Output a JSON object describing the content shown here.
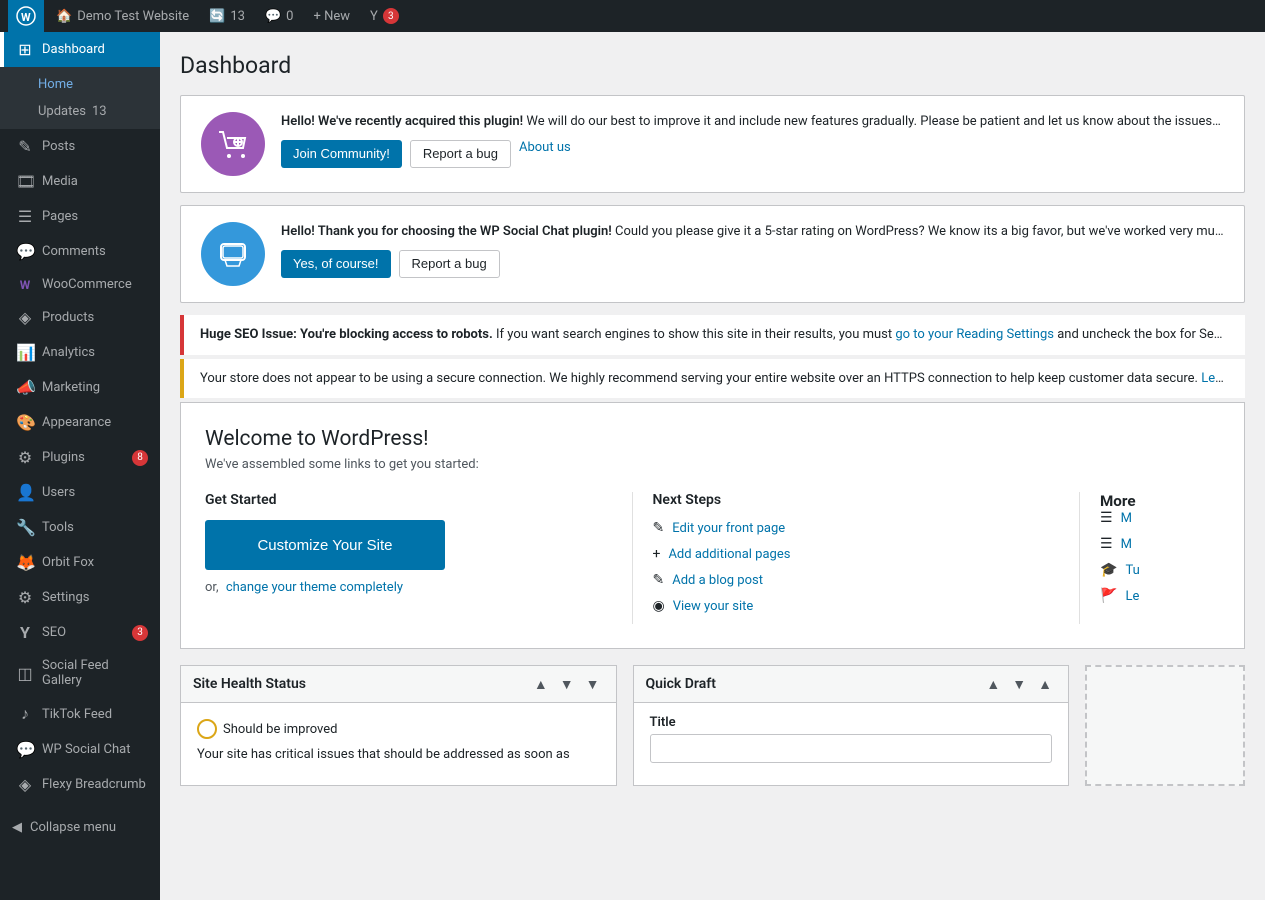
{
  "adminbar": {
    "wp_logo": "W",
    "site_name": "Demo Test Website",
    "comments_count": "0",
    "updates_count": "13",
    "new_label": "+ New",
    "yoast_label": "Y",
    "yoast_count": "3"
  },
  "sidebar": {
    "active_item": "Dashboard",
    "items": [
      {
        "id": "dashboard",
        "label": "Dashboard",
        "icon": "⊞",
        "badge": null,
        "active": true
      },
      {
        "id": "home",
        "label": "Home",
        "icon": null,
        "badge": null,
        "submenu": true,
        "subactive": true
      },
      {
        "id": "updates",
        "label": "Updates",
        "icon": null,
        "badge": "13",
        "submenu": true
      },
      {
        "id": "posts",
        "label": "Posts",
        "icon": "✎",
        "badge": null
      },
      {
        "id": "media",
        "label": "Media",
        "icon": "⊞",
        "badge": null
      },
      {
        "id": "pages",
        "label": "Pages",
        "icon": "☰",
        "badge": null
      },
      {
        "id": "comments",
        "label": "Comments",
        "icon": "💬",
        "badge": null
      },
      {
        "id": "woocommerce",
        "label": "WooCommerce",
        "icon": "W",
        "badge": null
      },
      {
        "id": "products",
        "label": "Products",
        "icon": "◈",
        "badge": null
      },
      {
        "id": "analytics",
        "label": "Analytics",
        "icon": "📊",
        "badge": null
      },
      {
        "id": "marketing",
        "label": "Marketing",
        "icon": "📣",
        "badge": null
      },
      {
        "id": "appearance",
        "label": "Appearance",
        "icon": "🎨",
        "badge": null
      },
      {
        "id": "plugins",
        "label": "Plugins",
        "icon": "⚙",
        "badge": "8"
      },
      {
        "id": "users",
        "label": "Users",
        "icon": "👤",
        "badge": null
      },
      {
        "id": "tools",
        "label": "Tools",
        "icon": "🔧",
        "badge": null
      },
      {
        "id": "orbit-fox",
        "label": "Orbit Fox",
        "icon": "🦊",
        "badge": null
      },
      {
        "id": "settings",
        "label": "Settings",
        "icon": "⚙",
        "badge": null
      },
      {
        "id": "seo",
        "label": "SEO",
        "icon": "Y",
        "badge": "3"
      },
      {
        "id": "social-feed",
        "label": "Social Feed Gallery",
        "icon": "◫",
        "badge": null
      },
      {
        "id": "tiktok-feed",
        "label": "TikTok Feed",
        "icon": "♪",
        "badge": null
      },
      {
        "id": "wp-social-chat",
        "label": "WP Social Chat",
        "icon": "💬",
        "badge": null
      },
      {
        "id": "flexy-breadcrumb",
        "label": "Flexy Breadcrumb",
        "icon": "◈",
        "badge": null
      }
    ],
    "collapse_label": "Collapse menu"
  },
  "page": {
    "title": "Dashboard",
    "notice1": {
      "icon": "🛒",
      "text_bold": "Hello! We've recently acquired this plugin!",
      "text_rest": "We will do our best to improve it and include new features gradually. Please be patient and let us know about the issues and improvements that you want to see in the...",
      "btn1": "Join Community!",
      "btn2": "Report a bug",
      "btn3": "About us"
    },
    "notice2": {
      "icon": "💬",
      "text_bold": "Hello! Thank you for choosing the WP Social Chat plugin!",
      "text_rest": "Could you please give it a 5-star rating on WordPress? We know its a big favor, but we've worked very much and very hard to release this great product. Your feedba...",
      "btn1": "Yes, of course!",
      "btn2": "Report a bug"
    },
    "alert_error": {
      "label": "Huge SEO Issue:",
      "text": "You're blocking access to robots.",
      "text2": "If you want search engines to show this site in their results, you must",
      "link_text": "go to your Reading Settings",
      "text3": "and uncheck the box for Search E..."
    },
    "alert_warning": {
      "text": "Your store does not appear to be using a secure connection. We highly recommend serving your entire website over an HTTPS connection to help keep customer data secure.",
      "link_text": "Learn m..."
    },
    "welcome": {
      "title": "Welcome to WordPress!",
      "subtitle": "We've assembled some links to get you started:",
      "get_started_title": "Get Started",
      "customize_btn": "Customize Your Site",
      "or_text": "or,",
      "change_theme_link": "change your theme completely",
      "next_steps_title": "Next Steps",
      "steps": [
        {
          "icon": "✎",
          "text": "Edit your front page"
        },
        {
          "icon": "+",
          "text": "Add additional pages"
        },
        {
          "icon": "✎",
          "text": "Add a blog post"
        },
        {
          "icon": "◉",
          "text": "View your site"
        }
      ],
      "more_title": "More",
      "more_items": [
        "M",
        "M",
        "Tu",
        "Le"
      ]
    },
    "site_health": {
      "title": "Site Health Status",
      "status": "Should be improved",
      "description": "Your site has critical issues that should be addressed as soon as"
    },
    "quick_draft": {
      "title": "Quick Draft",
      "title_label": "Title",
      "title_placeholder": ""
    }
  }
}
